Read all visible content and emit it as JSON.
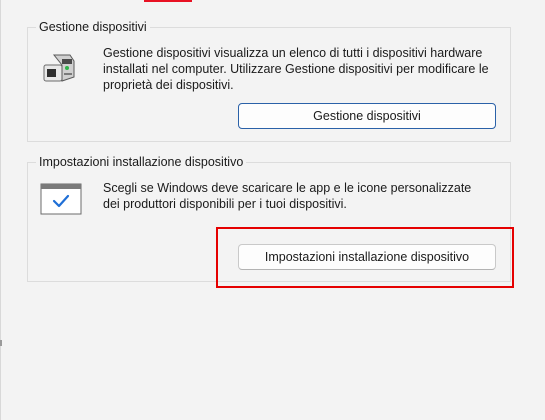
{
  "device_manager": {
    "title": "Gestione dispositivi",
    "description": "Gestione dispositivi visualizza un elenco di tutti i dispositivi hardware installati nel computer. Utilizzare Gestione dispositivi per modificare le proprietà dei dispositivi.",
    "button_label": "Gestione dispositivi",
    "icon": "device-manager-icon"
  },
  "device_installation": {
    "title": "Impostazioni installazione dispositivo",
    "description": "Scegli se Windows deve scaricare le app e le icone personalizzate dei produttori disponibili per i tuoi dispositivi.",
    "button_label": "Impostazioni installazione dispositivo",
    "icon": "installation-settings-icon"
  },
  "colors": {
    "highlight": "#e50000",
    "tab_accent": "#e81123",
    "focus_border": "#2a61a8",
    "check_blue": "#1f6fd6"
  }
}
